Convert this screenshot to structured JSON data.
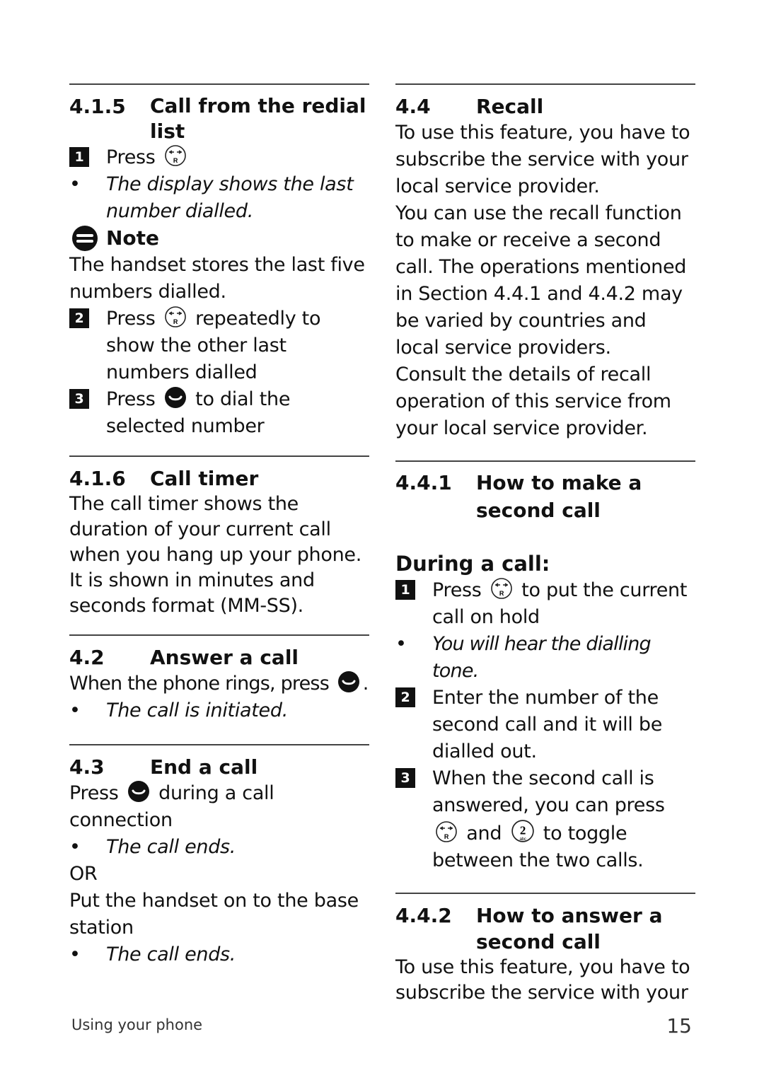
{
  "left": {
    "s415": {
      "num": "4.1.5",
      "title": "Call from the redial list",
      "step1": {
        "n": "1",
        "a": "Press"
      },
      "bullet1": "The display shows the last number dialled.",
      "note_title": "Note",
      "note_text": "The handset stores the last five numbers dialled.",
      "step2": {
        "n": "2",
        "a": "Press",
        "b": "repeatedly to show the other last numbers dialled"
      },
      "step3": {
        "n": "3",
        "a": "Press",
        "b": "to dial the selected number"
      }
    },
    "s416": {
      "num": "4.1.6",
      "title": "Call timer",
      "text": "The call timer shows the duration of your current call when you hang up your phone. It is shown in minutes and seconds format (MM-SS)."
    },
    "s42": {
      "num": "4.2",
      "title": "Answer a call",
      "text_a": "When the phone rings, press",
      "text_b": ".",
      "bullet": "The call is initiated."
    },
    "s43": {
      "num": "4.3",
      "title": "End a call",
      "text_a": "Press",
      "text_b": "during a call connection",
      "bullet1": "The call ends.",
      "or": "OR",
      "text2": "Put the handset on to the base station",
      "bullet2": "The call ends."
    }
  },
  "right": {
    "s44": {
      "num": "4.4",
      "title": "Recall",
      "p1": "To use this feature, you have to subscribe the service with your local service provider.",
      "p2": "You can use the recall function to make or receive a second call.  The operations mentioned in Section 4.4.1 and 4.4.2 may be varied by countries and local service providers.",
      "p3": "Consult the details of recall operation of this service from your local service provider."
    },
    "s441": {
      "num": "4.4.1",
      "title": "How to make a second call",
      "during": "During a call:",
      "step1": {
        "n": "1",
        "a": "Press",
        "b": "to put the current call on hold"
      },
      "bullet1": "You will hear the dialling tone.",
      "step2": {
        "n": "2",
        "a": "Enter the number of the second call and it will be dialled out."
      },
      "step3": {
        "n": "3",
        "a": "When the second call is answered, you can press",
        "b": "and",
        "c": "to toggle between the two calls."
      }
    },
    "s442": {
      "num": "4.4.2",
      "title": "How to answer a second call",
      "p1": "To use this feature, you have to subscribe the service with your"
    }
  },
  "footer": {
    "section": "Using your phone",
    "page": "15"
  },
  "icons": {
    "redial": "redial-R-key-icon",
    "talk": "talk-key-icon",
    "key2": "key-2-abc-icon",
    "note": "note-icon"
  }
}
